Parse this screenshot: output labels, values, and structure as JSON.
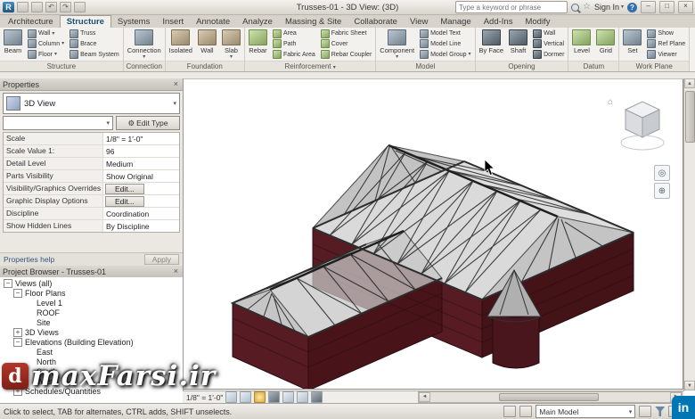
{
  "icons": {
    "caret": "▾",
    "close": "×",
    "minimize": "–",
    "maximize": "□",
    "star": "☆",
    "help": "?",
    "undo": "↶",
    "redo": "↷",
    "gear": "⚙",
    "home": "⌂",
    "wheel": "◎",
    "zoom": "⊕",
    "scroll_up": "▲",
    "scroll_down": "▼",
    "scroll_left": "◄",
    "scroll_right": "►",
    "grip": "◢"
  },
  "titlebar": {
    "logo": "R",
    "title": "Trusses-01 - 3D View: (3D)",
    "search_placeholder": "Type a keyword or phrase",
    "signin": "Sign In"
  },
  "tabs": [
    {
      "label": "Architecture"
    },
    {
      "label": "Structure"
    },
    {
      "label": "Systems"
    },
    {
      "label": "Insert"
    },
    {
      "label": "Annotate"
    },
    {
      "label": "Analyze"
    },
    {
      "label": "Massing & Site"
    },
    {
      "label": "Collaborate"
    },
    {
      "label": "View"
    },
    {
      "label": "Manage"
    },
    {
      "label": "Add-Ins"
    },
    {
      "label": "Modify"
    }
  ],
  "ribbon": {
    "panel_labels": [
      "Structure",
      "Connection",
      "Foundation",
      "Reinforcement",
      "Model",
      "Opening",
      "Datum",
      "Work Plane"
    ],
    "buttons": {
      "beam": "Beam",
      "wall": "Wall",
      "column": "Column",
      "floor": "Floor",
      "truss": "Truss",
      "brace": "Brace",
      "beam_system": "Beam System",
      "connection": "Connection",
      "isolated": "Isolated",
      "wall_foundation": "Wall",
      "slab": "Slab",
      "rebar": "Rebar",
      "area": "Area",
      "path": "Path",
      "fabric_area": "Fabric Area",
      "fabric_sheet": "Fabric Sheet",
      "cover": "Cover",
      "rebar_coupler": "Rebar Coupler",
      "component": "Component",
      "model_text": "Model Text",
      "model_line": "Model Line",
      "model_group": "Model Group",
      "by_face": "By Face",
      "shaft": "Shaft",
      "wall_opening": "Wall",
      "vertical": "Vertical",
      "dormer": "Dormer",
      "level": "Level",
      "grid": "Grid",
      "set": "Set",
      "show": "Show",
      "ref_plane": "Ref Plane",
      "viewer": "Viewer"
    }
  },
  "properties": {
    "title": "Properties",
    "type_selector": "3D View",
    "edit_type": "Edit Type",
    "rows": [
      {
        "label": "Scale",
        "value": "1/8\" = 1'-0\""
      },
      {
        "label": "Scale Value    1:",
        "value": "96"
      },
      {
        "label": "Detail Level",
        "value": "Medium"
      },
      {
        "label": "Parts Visibility",
        "value": "Show Original"
      },
      {
        "label": "Visibility/Graphics Overrides",
        "value": "Edit..."
      },
      {
        "label": "Graphic Display Options",
        "value": "Edit..."
      },
      {
        "label": "Discipline",
        "value": "Coordination"
      },
      {
        "label": "Show Hidden Lines",
        "value": "By Discipline"
      }
    ],
    "help": "Properties help",
    "apply": "Apply"
  },
  "browser": {
    "title": "Project Browser - Trusses-01",
    "items": [
      {
        "exp": "−",
        "indent": 0,
        "label": "Views (all)"
      },
      {
        "exp": "−",
        "indent": 1,
        "label": "Floor Plans"
      },
      {
        "exp": "",
        "indent": 2,
        "label": "Level 1"
      },
      {
        "exp": "",
        "indent": 2,
        "label": "ROOF"
      },
      {
        "exp": "",
        "indent": 2,
        "label": "Site"
      },
      {
        "exp": "+",
        "indent": 1,
        "label": "3D Views"
      },
      {
        "exp": "−",
        "indent": 1,
        "label": "Elevations (Building Elevation)"
      },
      {
        "exp": "",
        "indent": 2,
        "label": "East"
      },
      {
        "exp": "",
        "indent": 2,
        "label": "North"
      },
      {
        "exp": "",
        "indent": 2,
        "label": "South"
      },
      {
        "exp": "",
        "indent": 2,
        "label": "West"
      },
      {
        "exp": "+",
        "indent": 1,
        "label": "Schedules/Quantities"
      }
    ]
  },
  "viewbar": {
    "scale": "1/8\" = 1'-0\""
  },
  "statusbar": {
    "hint": "Click to select, TAB for alternates, CTRL adds, SHIFT unselects.",
    "main_model": "Main Model"
  },
  "watermark": {
    "logo": "d",
    "text": "maxFarsi.ir"
  },
  "badge": {
    "text": "in"
  }
}
